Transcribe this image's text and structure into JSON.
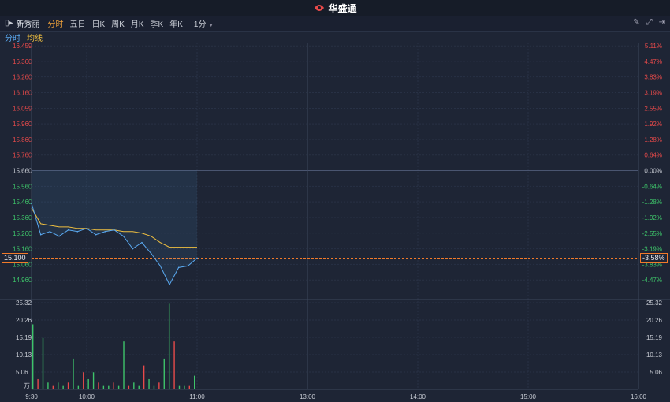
{
  "app": {
    "brand": "华盛通"
  },
  "toolbar": {
    "stock_name": "新秀丽",
    "periods": [
      "分时",
      "五日",
      "日K",
      "周K",
      "月K",
      "季K",
      "年K"
    ],
    "active_period": "分时",
    "interval": "1分"
  },
  "legend": {
    "series1": "分时",
    "series2": "均线"
  },
  "price_axis": {
    "left": [
      "16.459",
      "16.360",
      "16.260",
      "16.160",
      "16.059",
      "15.960",
      "15.860",
      "15.760",
      "15.660",
      "15.560",
      "15.460",
      "15.360",
      "15.260",
      "15.160",
      "15.060",
      "14.960"
    ],
    "right": [
      "5.11%",
      "4.47%",
      "3.83%",
      "3.19%",
      "2.55%",
      "1.92%",
      "1.28%",
      "0.64%",
      "0.00%",
      "-0.64%",
      "-1.28%",
      "-1.92%",
      "-2.55%",
      "-3.19%",
      "-3.83%",
      "-4.47%"
    ],
    "prev_close": "15.660",
    "current_price": "15.100",
    "current_pct": "-3.58%"
  },
  "volume_axis": {
    "labels": [
      "25.32",
      "20.26",
      "15.19",
      "10.13",
      "5.06"
    ],
    "unit": "万"
  },
  "time_axis": [
    "9:30",
    "10:00",
    "11:00",
    "13:00",
    "14:00",
    "15:00",
    "16:00"
  ],
  "colors": {
    "up": "#e84a4a",
    "down": "#3ec46a",
    "price_line": "#5aa9f0",
    "avg_line": "#f0c040",
    "accent": "#f0a23a"
  },
  "chart_data": {
    "type": "line",
    "x": [
      "9:30",
      "9:35",
      "9:40",
      "9:45",
      "9:50",
      "9:55",
      "10:00",
      "10:05",
      "10:10",
      "10:15",
      "10:20",
      "10:25",
      "10:30",
      "10:35",
      "10:40",
      "10:45",
      "10:50",
      "10:55",
      "11:00"
    ],
    "series": [
      {
        "name": "分时",
        "values": [
          15.45,
          15.25,
          15.27,
          15.24,
          15.28,
          15.27,
          15.29,
          15.25,
          15.27,
          15.28,
          15.24,
          15.16,
          15.2,
          15.13,
          15.05,
          14.93,
          15.04,
          15.05,
          15.1
        ]
      },
      {
        "name": "均线",
        "values": [
          15.42,
          15.32,
          15.31,
          15.3,
          15.3,
          15.29,
          15.29,
          15.28,
          15.28,
          15.28,
          15.27,
          15.27,
          15.26,
          15.24,
          15.2,
          15.17,
          15.17,
          15.17,
          15.17
        ]
      }
    ],
    "volume": [
      19,
      3,
      15,
      2,
      1,
      2,
      1,
      2,
      9,
      1,
      5,
      3,
      5,
      2,
      1,
      1,
      2,
      1,
      14,
      1,
      2,
      1,
      7,
      3,
      1,
      2,
      9,
      25,
      14,
      1,
      1,
      1,
      4
    ],
    "ylim": [
      14.86,
      16.46
    ],
    "prev_close": 15.66
  }
}
